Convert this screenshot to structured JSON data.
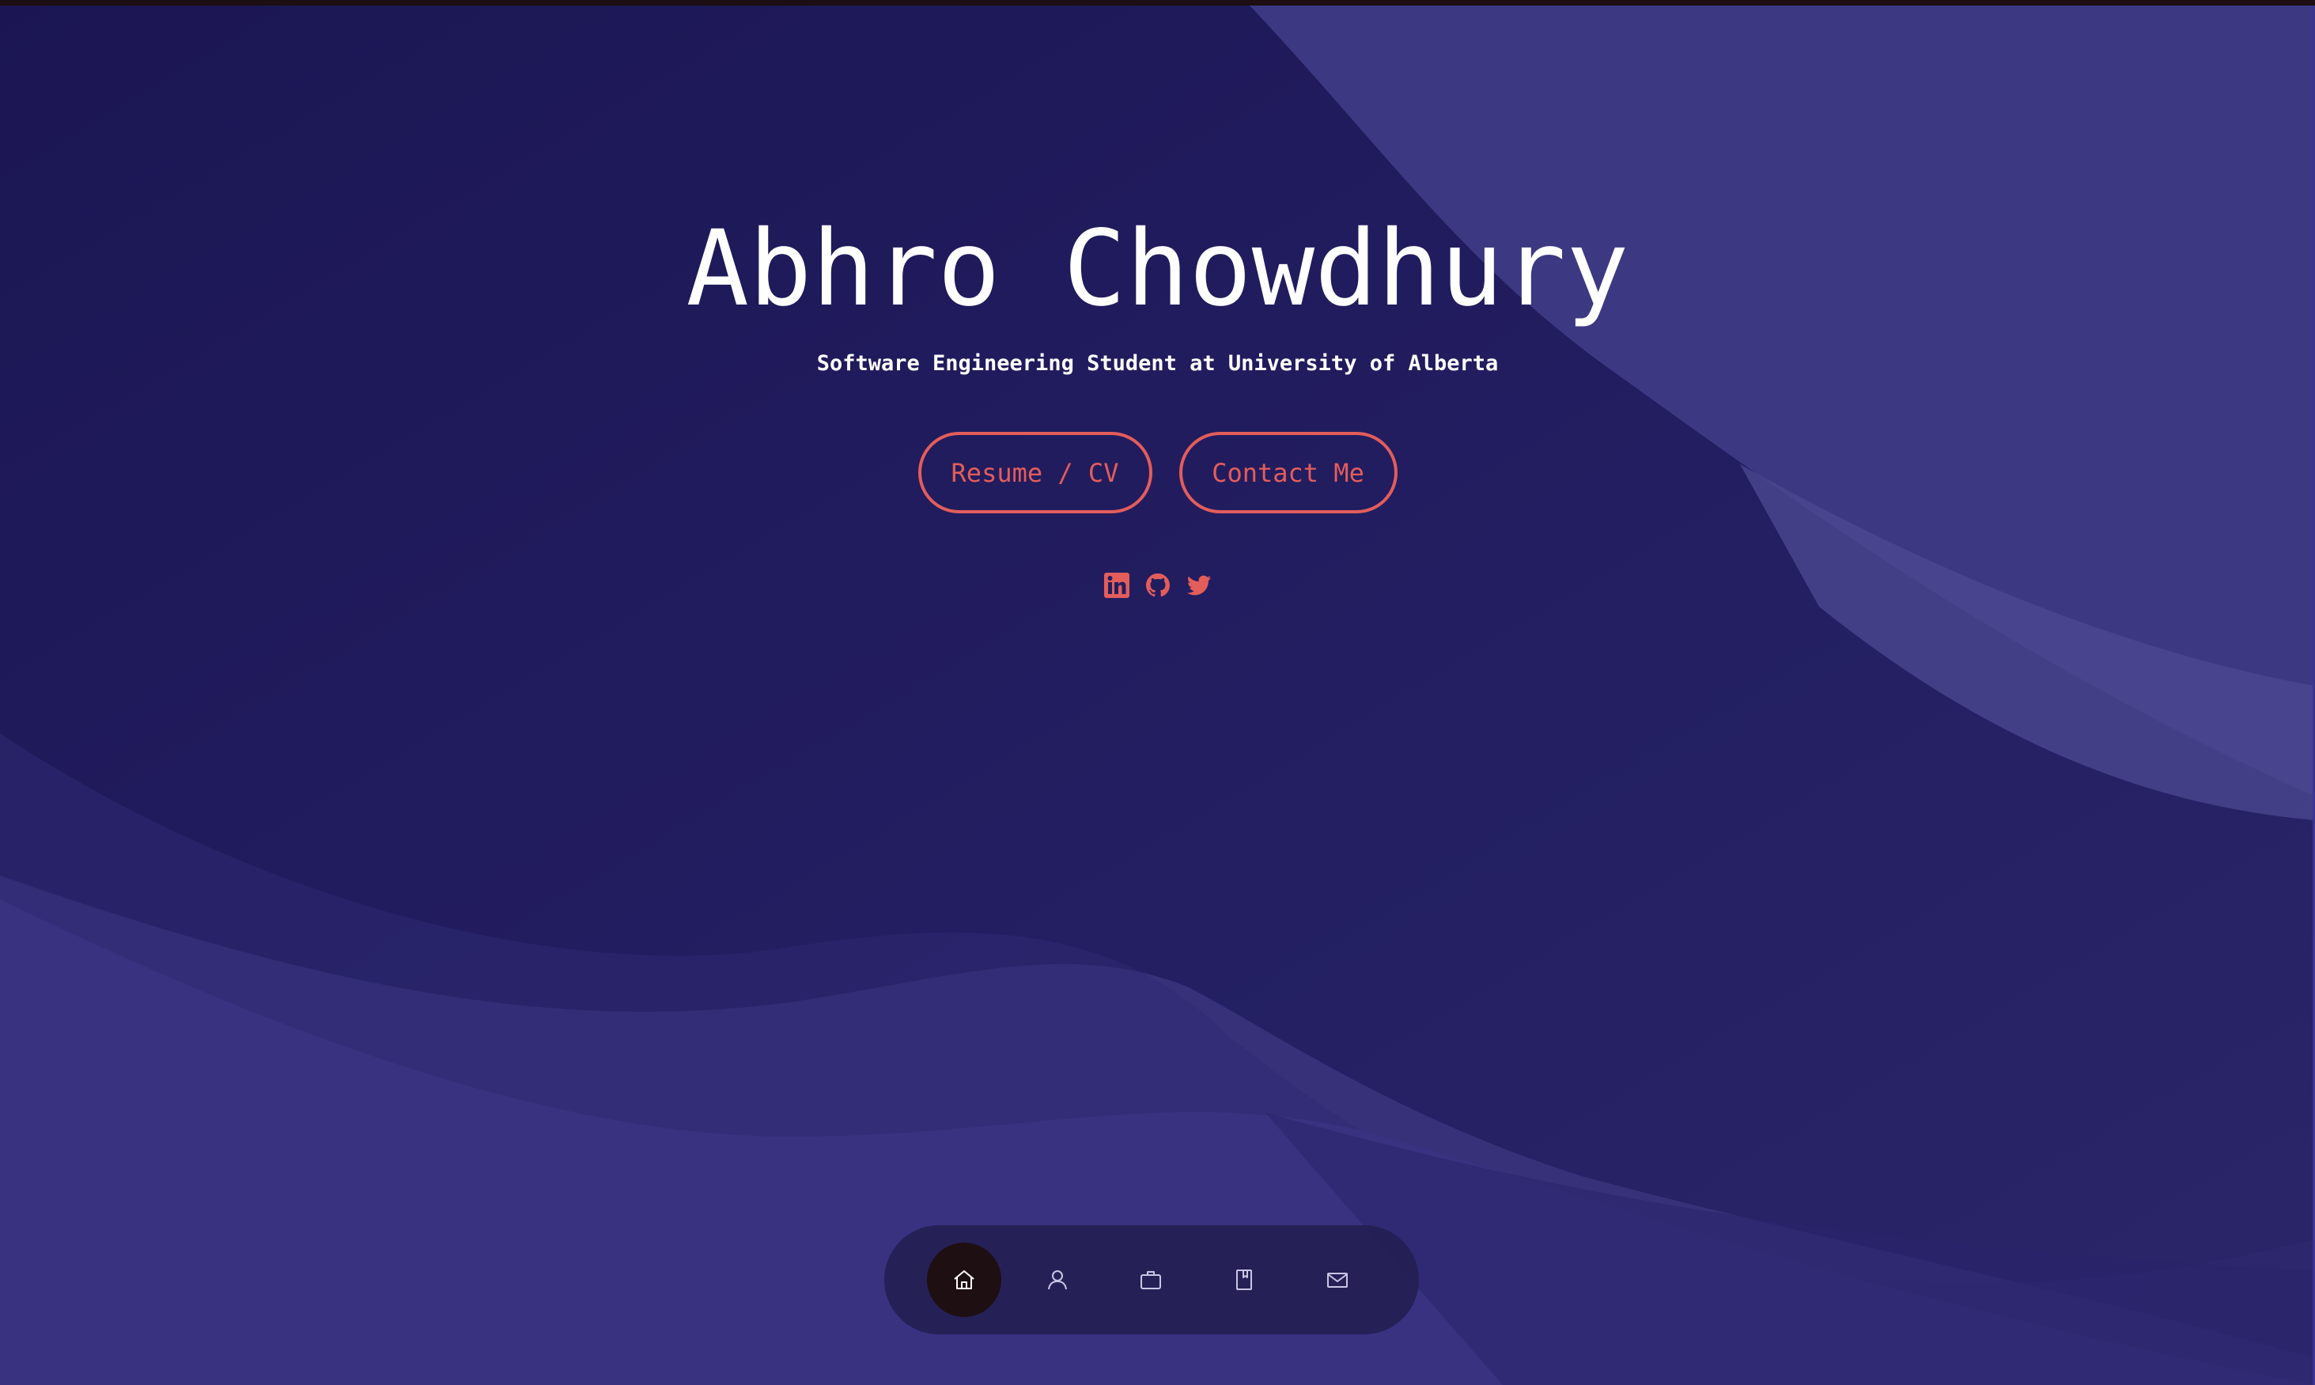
{
  "hero": {
    "name": "Abhro Chowdhury",
    "subtitle": "Software Engineering Student at University of Alberta"
  },
  "buttons": {
    "resume_label": "Resume / CV",
    "contact_label": "Contact Me"
  },
  "social": [
    {
      "icon": "linkedin-icon"
    },
    {
      "icon": "github-icon"
    },
    {
      "icon": "twitter-icon"
    }
  ],
  "dock": {
    "items": [
      {
        "icon": "home-icon",
        "active": true
      },
      {
        "icon": "user-icon",
        "active": false
      },
      {
        "icon": "briefcase-icon",
        "active": false
      },
      {
        "icon": "book-icon",
        "active": false
      },
      {
        "icon": "mail-icon",
        "active": false
      }
    ]
  },
  "colors": {
    "accent": "#e35d5b",
    "background": "#1f1a5a",
    "wave_light": "#3e3a86",
    "dock_active": "#1e0f12"
  }
}
